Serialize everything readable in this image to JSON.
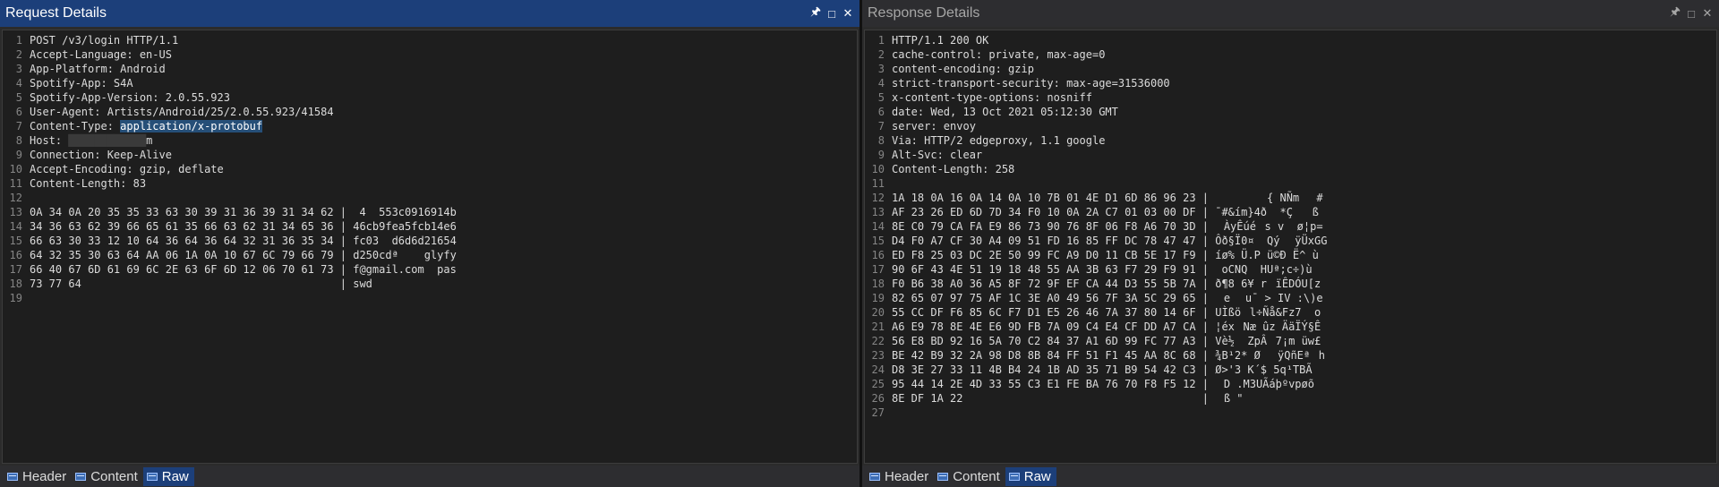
{
  "request": {
    "title": "Request Details",
    "lines": [
      "POST /v3/login HTTP/1.1",
      "Accept-Language: en-US",
      "App-Platform: Android",
      "Spotify-App: S4A",
      "Spotify-App-Version: 2.0.55.923",
      "User-Agent: Artists/Android/25/2.0.55.923/41584",
      "Content-Type: application/x-protobuf",
      "Host: ████████████m",
      "Connection: Keep-Alive",
      "Accept-Encoding: gzip, deflate",
      "Content-Length: 83",
      "",
      "0A 34 0A 20 35 35 33 63 30 39 31 36 39 31 34 62 |  4  553c0916914b",
      "34 36 63 62 39 66 65 61 35 66 63 62 31 34 65 36 | 46cb9fea5fcb14e6",
      "66 63 30 33 12 10 64 36 64 36 64 32 31 36 35 34 | fc03  d6d6d21654",
      "64 32 35 30 63 64 AA 06 1A 0A 10 67 6C 79 66 79 | d250cdª    glyfy",
      "66 40 67 6D 61 69 6C 2E 63 6F 6D 12 06 70 61 73 | f@gmail.com  pas",
      "73 77 64                                        | swd"
    ]
  },
  "response": {
    "title": "Response Details",
    "lines": [
      "HTTP/1.1 200 OK",
      "cache-control: private, max-age=0",
      "content-encoding: gzip",
      "strict-transport-security: max-age=31536000",
      "x-content-type-options: nosniff",
      "date: Wed, 13 Oct 2021 05:12:30 GMT",
      "server: envoy",
      "Via: HTTP/2 edgeproxy, 1.1 google",
      "Alt-Svc: clear",
      "Content-Length: 258",
      "",
      "1A 18 0A 16 0A 14 0A 10 7B 01 4E D1 6D 86 96 23 |         { NÑm#",
      "AF 23 26 ED 6D 7D 34 F0 10 0A 2A C7 01 03 00 DF | ¯#&ím}4ð  *Ç   ß",
      "8E C0 79 CA FA E9 86 73 90 76 8F 06 F8 A6 70 3D | ÀyÊúés v  ø¦p=",
      "D4 F0 A7 CF 30 A4 09 51 FD 16 85 FF DC 78 47 47 | Ôð§Ï0¤  Qý ÿÜxGG",
      "ED F8 25 03 DC 2E 50 99 FC A9 D0 11 CB 5E 17 F9 | íø% Ü.P ü©Ð Ë^ ù",
      "90 6F 43 4E 51 19 18 48 55 AA 3B 63 F7 29 F9 91 |  oCNQ  HUª;c÷)ù",
      "F0 B6 38 A0 36 A5 8F 72 9F EF CA 44 D3 55 5B 7A | ð¶8 6¥ rïÊDÓU[z",
      "82 65 07 97 75 AF 1C 3E A0 49 56 7F 3A 5C 29 65 | e u¯ > IV :\\)e",
      "55 CC DF F6 85 6C F7 D1 E5 26 46 7A 37 80 14 6F | UÌßöl÷Ñå&Fz7  o",
      "A6 E9 78 8E 4E E6 9D FB 7A 09 C4 E4 CF DD A7 CA | ¦éxNæ ûz ÄäÏÝ§Ê",
      "56 E8 BD 92 16 5A 70 C2 84 37 A1 6D 99 FC 77 A3 | Vè½ ZpÂ7¡m üw£",
      "BE 42 B9 32 2A 98 D8 8B 84 FF 51 F1 45 AA 8C 68 | ¾B¹2* ØÿQñEªh",
      "D8 3E 27 33 11 4B B4 24 1B AD 35 71 B9 54 42 C3 | Ø>'3 K´$ ­5q¹TBÃ",
      "95 44 14 2E 4D 33 55 C3 E1 FE BA 76 70 F8 F5 12 | D .M3UÃáþºvpøõ ",
      "8E DF 1A 22                                     | ß \""
    ]
  },
  "tabs": [
    "Header",
    "Content",
    "Raw"
  ],
  "selected_tab": "Raw",
  "icons": {
    "pin": "pin-icon",
    "maximize": "maximize-icon",
    "close": "close-icon",
    "tab": "view-icon"
  }
}
